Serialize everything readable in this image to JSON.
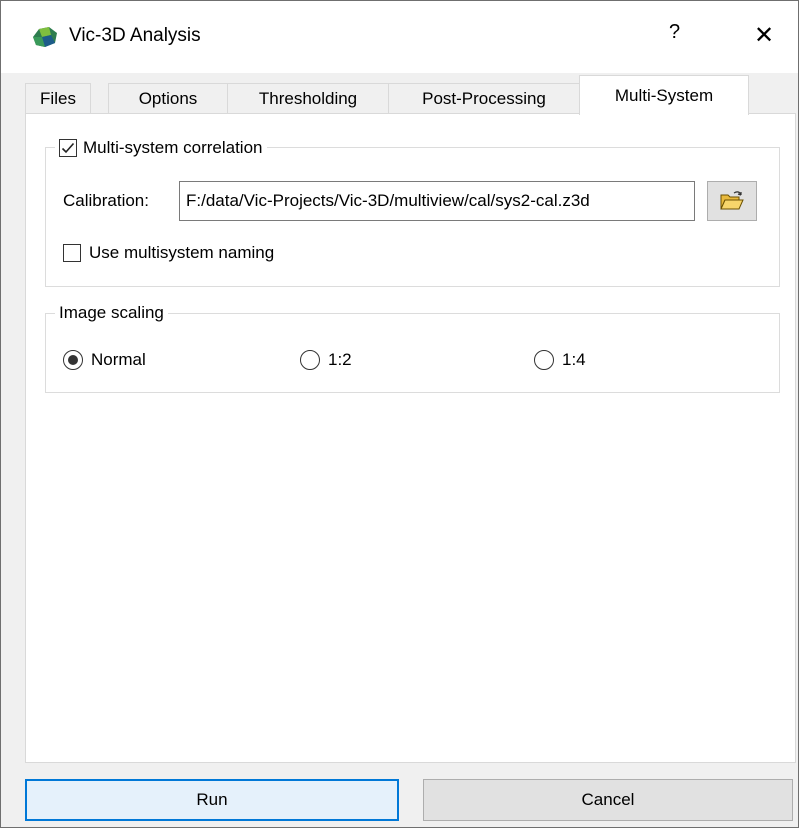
{
  "window": {
    "title": "Vic-3D Analysis",
    "help": "?",
    "close": "✕"
  },
  "tabs": [
    {
      "label": "Files",
      "active": false
    },
    {
      "label": "Options",
      "active": false
    },
    {
      "label": "Thresholding",
      "active": false
    },
    {
      "label": "Post-Processing",
      "active": false
    },
    {
      "label": "Multi-System",
      "active": true
    }
  ],
  "multi_system": {
    "group_label": "Multi-system correlation",
    "enabled": true,
    "calibration_label": "Calibration:",
    "calibration_value": "F:/data/Vic-Projects/Vic-3D/multiview/cal/sys2-cal.z3d",
    "browse_icon": "folder-open-icon",
    "naming_label": "Use multisystem naming",
    "naming_checked": false
  },
  "image_scaling": {
    "group_label": "Image scaling",
    "options": [
      {
        "label": "Normal",
        "selected": true
      },
      {
        "label": "1:2",
        "selected": false
      },
      {
        "label": "1:4",
        "selected": false
      }
    ]
  },
  "buttons": {
    "run": "Run",
    "cancel": "Cancel"
  },
  "colors": {
    "accent": "#0078d7",
    "panel": "#ffffff",
    "chrome": "#f0f0f0"
  }
}
